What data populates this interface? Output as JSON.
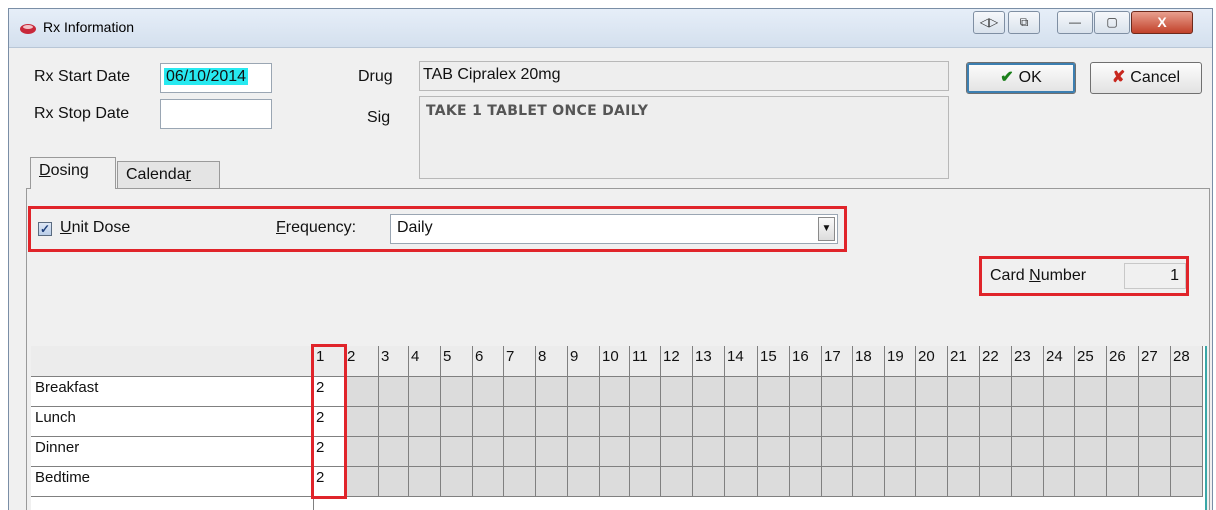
{
  "window": {
    "title": "Rx Information",
    "caption_buttons": {
      "extra1": "◁▷",
      "extra2": "⧉",
      "minimize": "—",
      "maximize": "▢",
      "close": "X"
    }
  },
  "form": {
    "start_date_label": "Rx Start Date",
    "start_date_value": "06/10/2014",
    "stop_date_label": "Rx Stop Date",
    "stop_date_value": "",
    "drug_label": "Drug",
    "drug_value": "TAB Cipralex 20mg",
    "sig_label": "Sig",
    "sig_value": "TAKE 1 TABLET ONCE DAILY"
  },
  "buttons": {
    "ok": "OK",
    "cancel": "Cancel"
  },
  "tabs": [
    {
      "pre": "",
      "u": "D",
      "post": "osing"
    },
    {
      "pre": "Calenda",
      "u": "r",
      "post": ""
    }
  ],
  "dosing": {
    "unit_dose_checked": true,
    "unit_dose_u": "U",
    "unit_dose_rest": "nit Dose",
    "frequency_u": "F",
    "frequency_rest": "requency:",
    "frequency_value": "Daily",
    "card_number_pre": "Card ",
    "card_number_u": "N",
    "card_number_post": "umber",
    "card_number_value": "1"
  },
  "grid": {
    "day_headers": [
      "1",
      "2",
      "3",
      "4",
      "5",
      "6",
      "7",
      "8",
      "9",
      "10",
      "11",
      "12",
      "13",
      "14",
      "15",
      "16",
      "17",
      "18",
      "19",
      "20",
      "21",
      "22",
      "23",
      "24",
      "25",
      "26",
      "27",
      "28"
    ],
    "rows": [
      {
        "label": "Breakfast",
        "values": [
          "2"
        ]
      },
      {
        "label": "Lunch",
        "values": [
          "2"
        ]
      },
      {
        "label": "Dinner",
        "values": [
          "2"
        ]
      },
      {
        "label": "Bedtime",
        "values": [
          "2"
        ]
      }
    ]
  },
  "colors": {
    "highlight": "#e0242a",
    "date_highlight": "#27e9f0",
    "ok_check": "#1a7f1a",
    "cancel_x": "#c8281f"
  }
}
